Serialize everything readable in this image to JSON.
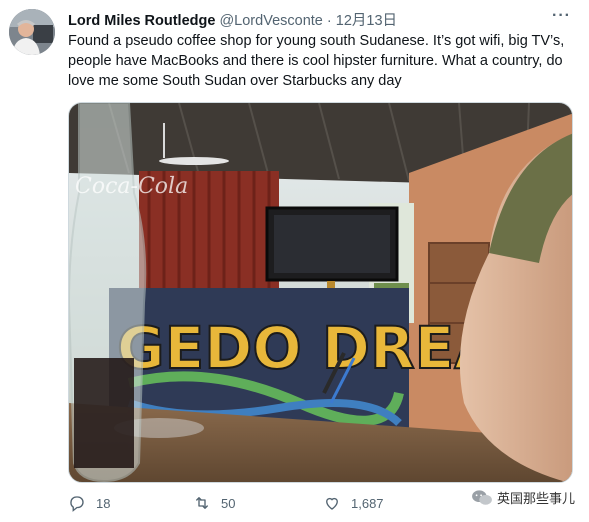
{
  "tweet": {
    "display_name": "Lord Miles Routledge",
    "handle": "@LordVesconte",
    "separator": "·",
    "date": "12月13日",
    "text": "Found a pseudo coffee shop for young south Sudanese. It’s got wifi, big TV’s, people have MacBooks and there is cool hipster furniture. What a country, do love me some South Sudan over Starbucks any day",
    "more_label": "···"
  },
  "photo": {
    "bottle_text": "Coca-Cola",
    "graffiti_text": "GEDO DREAM"
  },
  "actions": {
    "reply_count": "18",
    "retweet_count": "50",
    "like_count": "1,687"
  },
  "watermark": {
    "text": "英国那些事儿"
  },
  "colors": {
    "text": "#0f1419",
    "muted": "#536471",
    "border": "#cfd9de"
  },
  "icons": [
    "reply-icon",
    "retweet-icon",
    "like-icon",
    "share-icon",
    "more-icon",
    "wechat-icon"
  ]
}
